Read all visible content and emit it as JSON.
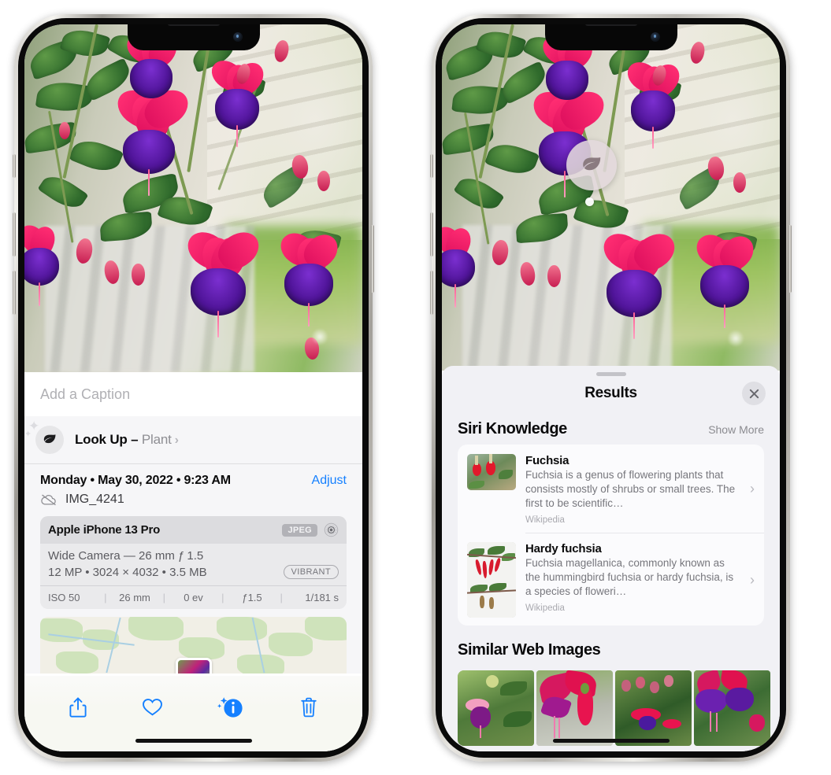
{
  "left_phone": {
    "name": "iphone-photos-info",
    "caption_field": {
      "placeholder": "Add a Caption",
      "value": ""
    },
    "lookup_row": {
      "label": "Look Up – ",
      "subject": "Plant",
      "chevron": "›",
      "icon": "leaf-icon"
    },
    "date_row": {
      "date_text": "Monday • May 30, 2022 • 9:23 AM",
      "adjust_label": "Adjust"
    },
    "file_row": {
      "icon": "icloud-slash-icon",
      "filename": "IMG_4241"
    },
    "metadata_card": {
      "device": "Apple iPhone 13 Pro",
      "format_badge": "JPEG",
      "raw_icon": "aperture-icon",
      "lens": "Wide Camera — 26 mm ƒ 1.5",
      "size_line": "12 MP • 3024 × 4032 • 3.5 MB",
      "style_badge": "VIBRANT",
      "exif": [
        "ISO 50",
        "26 mm",
        "0 ev",
        "ƒ1.5",
        "1/181 s"
      ],
      "exif_separator": "|"
    },
    "toolbar": [
      {
        "name": "share-icon",
        "label": "Share"
      },
      {
        "name": "heart-icon",
        "label": "Favorite"
      },
      {
        "name": "info-sparkle-icon",
        "label": "Info"
      },
      {
        "name": "trash-icon",
        "label": "Delete"
      }
    ]
  },
  "right_phone": {
    "name": "iphone-visual-lookup-results",
    "badge": {
      "icon": "leaf-icon",
      "name": "visual-lookup-badge"
    },
    "sheet": {
      "title": "Results",
      "close_icon": "close-icon",
      "sections": [
        {
          "title": "Siri Knowledge",
          "action": "Show More",
          "cards": [
            {
              "title": "Fuchsia",
              "description": "Fuchsia is a genus of flowering plants that consists mostly of shrubs or small trees. The first to be scientific…",
              "source": "Wikipedia",
              "chevron": "›"
            },
            {
              "title": "Hardy fuchsia",
              "description": "Fuchsia magellanica, commonly known as the hummingbird fuchsia or hardy fuchsia, is a species of floweri…",
              "source": "Wikipedia",
              "chevron": "›"
            }
          ]
        },
        {
          "title": "Similar Web Images",
          "action": "",
          "images": [
            {
              "alt": "pink-and-magenta-fuchsia-with-leaves"
            },
            {
              "alt": "red-fuchsia-closeup"
            },
            {
              "alt": "fuchsia-shrub-with-buds"
            },
            {
              "alt": "purple-and-red-fuchsia-cluster"
            }
          ]
        }
      ]
    }
  },
  "colors": {
    "accent_blue": "#1580ff",
    "sheet_bg": "#f1f1f5",
    "card_bg": "#fbfbfd",
    "secondary_text": "#8e8e93",
    "meta_card_bg": "#eaeaec"
  }
}
